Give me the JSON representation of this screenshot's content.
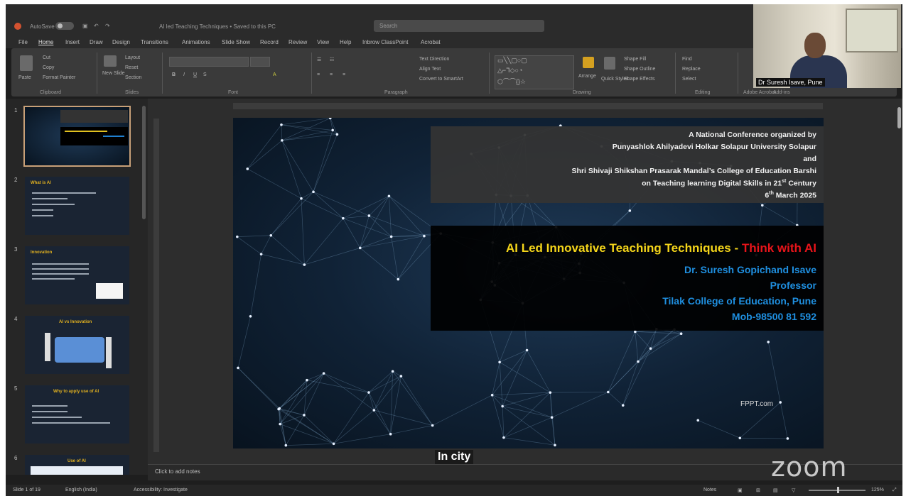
{
  "window": {
    "autosave_label": "AutoSave",
    "file_title": "AI led Teaching Techniques • Saved to this PC",
    "search_placeholder": "Search"
  },
  "menu": [
    "File",
    "Home",
    "Insert",
    "Draw",
    "Design",
    "Transitions",
    "Animations",
    "Slide Show",
    "Record",
    "Review",
    "View",
    "Help",
    "Inbrow ClassPoint",
    "Acrobat"
  ],
  "ribbon": {
    "groups": [
      "Clipboard",
      "Slides",
      "Font",
      "Paragraph",
      "Drawing",
      "Editing",
      "Adobe Acrobat",
      "Add-ins"
    ],
    "clipboard": {
      "paste": "Paste",
      "cut": "Cut",
      "copy": "Copy",
      "format_painter": "Format Painter"
    },
    "slides": {
      "new_slide": "New Slide",
      "layout": "Layout",
      "reset": "Reset",
      "section": "Section"
    },
    "drawing": {
      "arrange": "Arrange",
      "quick_styles": "Quick Styles",
      "shape_fill": "Shape Fill",
      "shape_outline": "Shape Outline",
      "shape_effects": "Shape Effects"
    },
    "editing": {
      "find": "Find",
      "replace": "Replace",
      "select": "Select"
    },
    "paragraph": {
      "text_direction": "Text Direction",
      "align_text": "Align Text",
      "smartart": "Convert to SmartArt"
    }
  },
  "thumbnails": [
    {
      "num": "1",
      "title": "",
      "selected": true
    },
    {
      "num": "2",
      "title": "What is AI",
      "selected": false
    },
    {
      "num": "3",
      "title": "Innovation",
      "selected": false
    },
    {
      "num": "4",
      "title": "AI vs Innovation",
      "selected": false
    },
    {
      "num": "5",
      "title": "Why to apply use of AI",
      "selected": false
    },
    {
      "num": "6",
      "title": "Use of AI",
      "selected": false
    }
  ],
  "slide": {
    "org_lines": [
      "A National Conference organized by",
      "Punyashlok Ahilyadevi Holkar Solapur University Solapur",
      "and",
      "Shri Shivaji Shikshan Prasarak Mandal’s College of Education Barshi",
      "on Teaching learning Digital Skills in 21",
      "6",
      "March 2025"
    ],
    "century_sup": "st",
    "century_word": "Century",
    "date_sup": "th",
    "title_main": "AI Led Innovative Teaching Techniques - ",
    "title_highlight": "Think with AI",
    "speaker_lines": [
      "Dr. Suresh Gopichand Isave",
      "Professor",
      "Tilak College of Education, Pune",
      "Mob-98500 81 592"
    ],
    "footer_brand": "FPPT.com"
  },
  "notes_placeholder": "Click to add notes",
  "caption": "In city",
  "zoom_brand": "zoom",
  "webcam": {
    "name_label": "Dr Suresh Isave, Pune"
  },
  "statusbar": {
    "slide_counter": "Slide 1 of 19",
    "language": "English (India)",
    "accessibility": "Accessibility: Investigate",
    "notes": "Notes",
    "zoom_level": "125%"
  },
  "colors": {
    "title_yellow": "#f5d61a",
    "title_red": "#e8141a",
    "speaker_blue": "#1f8fe0",
    "selected_thumb": "#c8a078"
  }
}
